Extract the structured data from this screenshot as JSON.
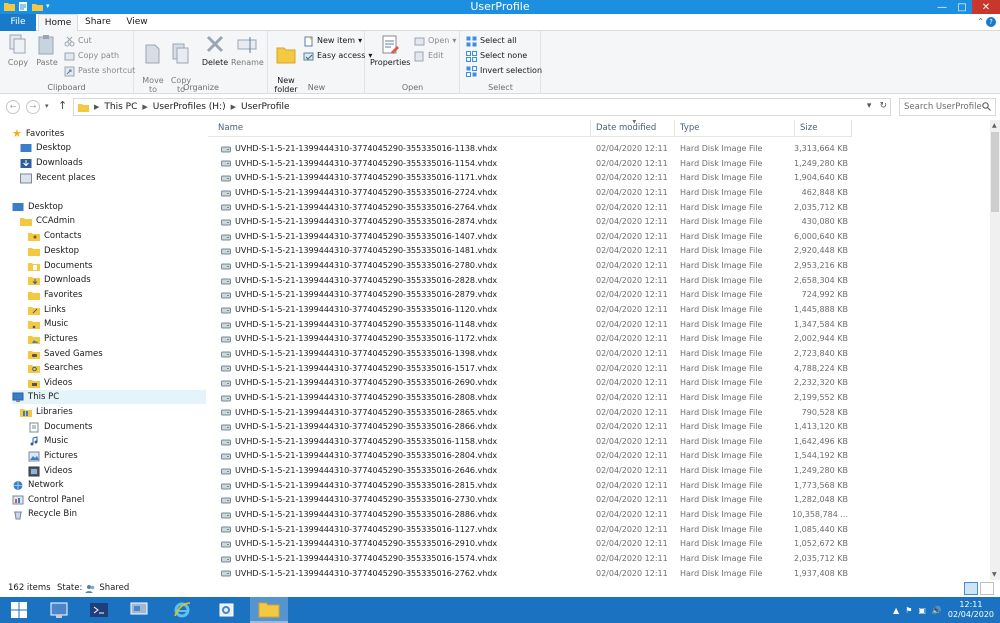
{
  "window": {
    "title": "UserProfile"
  },
  "tabs": [
    {
      "label": "File"
    },
    {
      "label": "Home"
    },
    {
      "label": "Share"
    },
    {
      "label": "View"
    }
  ],
  "ribbon": {
    "clipboard": {
      "label": "Clipboard",
      "copy": "Copy",
      "paste": "Paste",
      "cut": "Cut",
      "copy_path": "Copy path",
      "paste_shortcut": "Paste shortcut"
    },
    "organize": {
      "label": "Organize",
      "move_to": "Move\nto",
      "copy_to": "Copy\nto",
      "delete": "Delete",
      "rename": "Rename"
    },
    "new": {
      "label": "New",
      "new_folder": "New\nfolder",
      "new_item": "New item",
      "easy_access": "Easy access"
    },
    "open": {
      "label": "Open",
      "properties": "Properties",
      "open": "Open",
      "edit": "Edit"
    },
    "select": {
      "label": "Select",
      "select_all": "Select all",
      "select_none": "Select none",
      "invert_selection": "Invert selection"
    }
  },
  "address": {
    "crumbs": [
      "This PC",
      "UserProfiles (H:)",
      "UserProfile"
    ],
    "search_placeholder": "Search UserProfile"
  },
  "nav": {
    "favorites": "Favorites",
    "desktop_fav": "Desktop",
    "downloads_fav": "Downloads",
    "recent": "Recent places",
    "desktop": "Desktop",
    "ccadmin": "CCAdmin",
    "contacts": "Contacts",
    "desktop2": "Desktop",
    "documents": "Documents",
    "downloads": "Downloads",
    "favorites2": "Favorites",
    "links": "Links",
    "music": "Music",
    "pictures": "Pictures",
    "saved_games": "Saved Games",
    "searches": "Searches",
    "videos": "Videos",
    "this_pc": "This PC",
    "libraries": "Libraries",
    "lib_documents": "Documents",
    "lib_music": "Music",
    "lib_pictures": "Pictures",
    "lib_videos": "Videos",
    "network": "Network",
    "control_panel": "Control Panel",
    "recycle_bin": "Recycle Bin"
  },
  "columns": {
    "name": "Name",
    "date": "Date modified",
    "type": "Type",
    "size": "Size"
  },
  "files": [
    {
      "name": "UVHD-S-1-5-21-1399444310-3774045290-355335016-1138.vhdx",
      "date": "02/04/2020 12:11",
      "type": "Hard Disk Image File",
      "size": "3,313,664 KB"
    },
    {
      "name": "UVHD-S-1-5-21-1399444310-3774045290-355335016-1154.vhdx",
      "date": "02/04/2020 12:11",
      "type": "Hard Disk Image File",
      "size": "1,249,280 KB"
    },
    {
      "name": "UVHD-S-1-5-21-1399444310-3774045290-355335016-1171.vhdx",
      "date": "02/04/2020 12:11",
      "type": "Hard Disk Image File",
      "size": "1,904,640 KB"
    },
    {
      "name": "UVHD-S-1-5-21-1399444310-3774045290-355335016-2724.vhdx",
      "date": "02/04/2020 12:11",
      "type": "Hard Disk Image File",
      "size": "462,848 KB"
    },
    {
      "name": "UVHD-S-1-5-21-1399444310-3774045290-355335016-2764.vhdx",
      "date": "02/04/2020 12:11",
      "type": "Hard Disk Image File",
      "size": "2,035,712 KB"
    },
    {
      "name": "UVHD-S-1-5-21-1399444310-3774045290-355335016-2874.vhdx",
      "date": "02/04/2020 12:11",
      "type": "Hard Disk Image File",
      "size": "430,080 KB"
    },
    {
      "name": "UVHD-S-1-5-21-1399444310-3774045290-355335016-1407.vhdx",
      "date": "02/04/2020 12:11",
      "type": "Hard Disk Image File",
      "size": "6,000,640 KB"
    },
    {
      "name": "UVHD-S-1-5-21-1399444310-3774045290-355335016-1481.vhdx",
      "date": "02/04/2020 12:11",
      "type": "Hard Disk Image File",
      "size": "2,920,448 KB"
    },
    {
      "name": "UVHD-S-1-5-21-1399444310-3774045290-355335016-2780.vhdx",
      "date": "02/04/2020 12:11",
      "type": "Hard Disk Image File",
      "size": "2,953,216 KB"
    },
    {
      "name": "UVHD-S-1-5-21-1399444310-3774045290-355335016-2828.vhdx",
      "date": "02/04/2020 12:11",
      "type": "Hard Disk Image File",
      "size": "2,658,304 KB"
    },
    {
      "name": "UVHD-S-1-5-21-1399444310-3774045290-355335016-2879.vhdx",
      "date": "02/04/2020 12:11",
      "type": "Hard Disk Image File",
      "size": "724,992 KB"
    },
    {
      "name": "UVHD-S-1-5-21-1399444310-3774045290-355335016-1120.vhdx",
      "date": "02/04/2020 12:11",
      "type": "Hard Disk Image File",
      "size": "1,445,888 KB"
    },
    {
      "name": "UVHD-S-1-5-21-1399444310-3774045290-355335016-1148.vhdx",
      "date": "02/04/2020 12:11",
      "type": "Hard Disk Image File",
      "size": "1,347,584 KB"
    },
    {
      "name": "UVHD-S-1-5-21-1399444310-3774045290-355335016-1172.vhdx",
      "date": "02/04/2020 12:11",
      "type": "Hard Disk Image File",
      "size": "2,002,944 KB"
    },
    {
      "name": "UVHD-S-1-5-21-1399444310-3774045290-355335016-1398.vhdx",
      "date": "02/04/2020 12:11",
      "type": "Hard Disk Image File",
      "size": "2,723,840 KB"
    },
    {
      "name": "UVHD-S-1-5-21-1399444310-3774045290-355335016-1517.vhdx",
      "date": "02/04/2020 12:11",
      "type": "Hard Disk Image File",
      "size": "4,788,224 KB"
    },
    {
      "name": "UVHD-S-1-5-21-1399444310-3774045290-355335016-2690.vhdx",
      "date": "02/04/2020 12:11",
      "type": "Hard Disk Image File",
      "size": "2,232,320 KB"
    },
    {
      "name": "UVHD-S-1-5-21-1399444310-3774045290-355335016-2808.vhdx",
      "date": "02/04/2020 12:11",
      "type": "Hard Disk Image File",
      "size": "2,199,552 KB"
    },
    {
      "name": "UVHD-S-1-5-21-1399444310-3774045290-355335016-2865.vhdx",
      "date": "02/04/2020 12:11",
      "type": "Hard Disk Image File",
      "size": "790,528 KB"
    },
    {
      "name": "UVHD-S-1-5-21-1399444310-3774045290-355335016-2866.vhdx",
      "date": "02/04/2020 12:11",
      "type": "Hard Disk Image File",
      "size": "1,413,120 KB"
    },
    {
      "name": "UVHD-S-1-5-21-1399444310-3774045290-355335016-1158.vhdx",
      "date": "02/04/2020 12:11",
      "type": "Hard Disk Image File",
      "size": "1,642,496 KB"
    },
    {
      "name": "UVHD-S-1-5-21-1399444310-3774045290-355335016-2804.vhdx",
      "date": "02/04/2020 12:11",
      "type": "Hard Disk Image File",
      "size": "1,544,192 KB"
    },
    {
      "name": "UVHD-S-1-5-21-1399444310-3774045290-355335016-2646.vhdx",
      "date": "02/04/2020 12:11",
      "type": "Hard Disk Image File",
      "size": "1,249,280 KB"
    },
    {
      "name": "UVHD-S-1-5-21-1399444310-3774045290-355335016-2815.vhdx",
      "date": "02/04/2020 12:11",
      "type": "Hard Disk Image File",
      "size": "1,773,568 KB"
    },
    {
      "name": "UVHD-S-1-5-21-1399444310-3774045290-355335016-2730.vhdx",
      "date": "02/04/2020 12:11",
      "type": "Hard Disk Image File",
      "size": "1,282,048 KB"
    },
    {
      "name": "UVHD-S-1-5-21-1399444310-3774045290-355335016-2886.vhdx",
      "date": "02/04/2020 12:11",
      "type": "Hard Disk Image File",
      "size": "10,358,784 ..."
    },
    {
      "name": "UVHD-S-1-5-21-1399444310-3774045290-355335016-1127.vhdx",
      "date": "02/04/2020 12:11",
      "type": "Hard Disk Image File",
      "size": "1,085,440 KB"
    },
    {
      "name": "UVHD-S-1-5-21-1399444310-3774045290-355335016-2910.vhdx",
      "date": "02/04/2020 12:11",
      "type": "Hard Disk Image File",
      "size": "1,052,672 KB"
    },
    {
      "name": "UVHD-S-1-5-21-1399444310-3774045290-355335016-1574.vhdx",
      "date": "02/04/2020 12:11",
      "type": "Hard Disk Image File",
      "size": "2,035,712 KB"
    },
    {
      "name": "UVHD-S-1-5-21-1399444310-3774045290-355335016-2762.vhdx",
      "date": "02/04/2020 12:11",
      "type": "Hard Disk Image File",
      "size": "1,937,408 KB"
    }
  ],
  "status": {
    "count": "162 items",
    "state_label": "State:",
    "state_value": "Shared"
  },
  "taskbar": {
    "time": "12:11",
    "date": "02/04/2020"
  },
  "colors": {
    "titlebar": "#1d8fe0",
    "file_tab": "#1979ca",
    "taskbar": "#1b72c1",
    "close": "#c7372c",
    "selection": "#e5f3fb"
  }
}
